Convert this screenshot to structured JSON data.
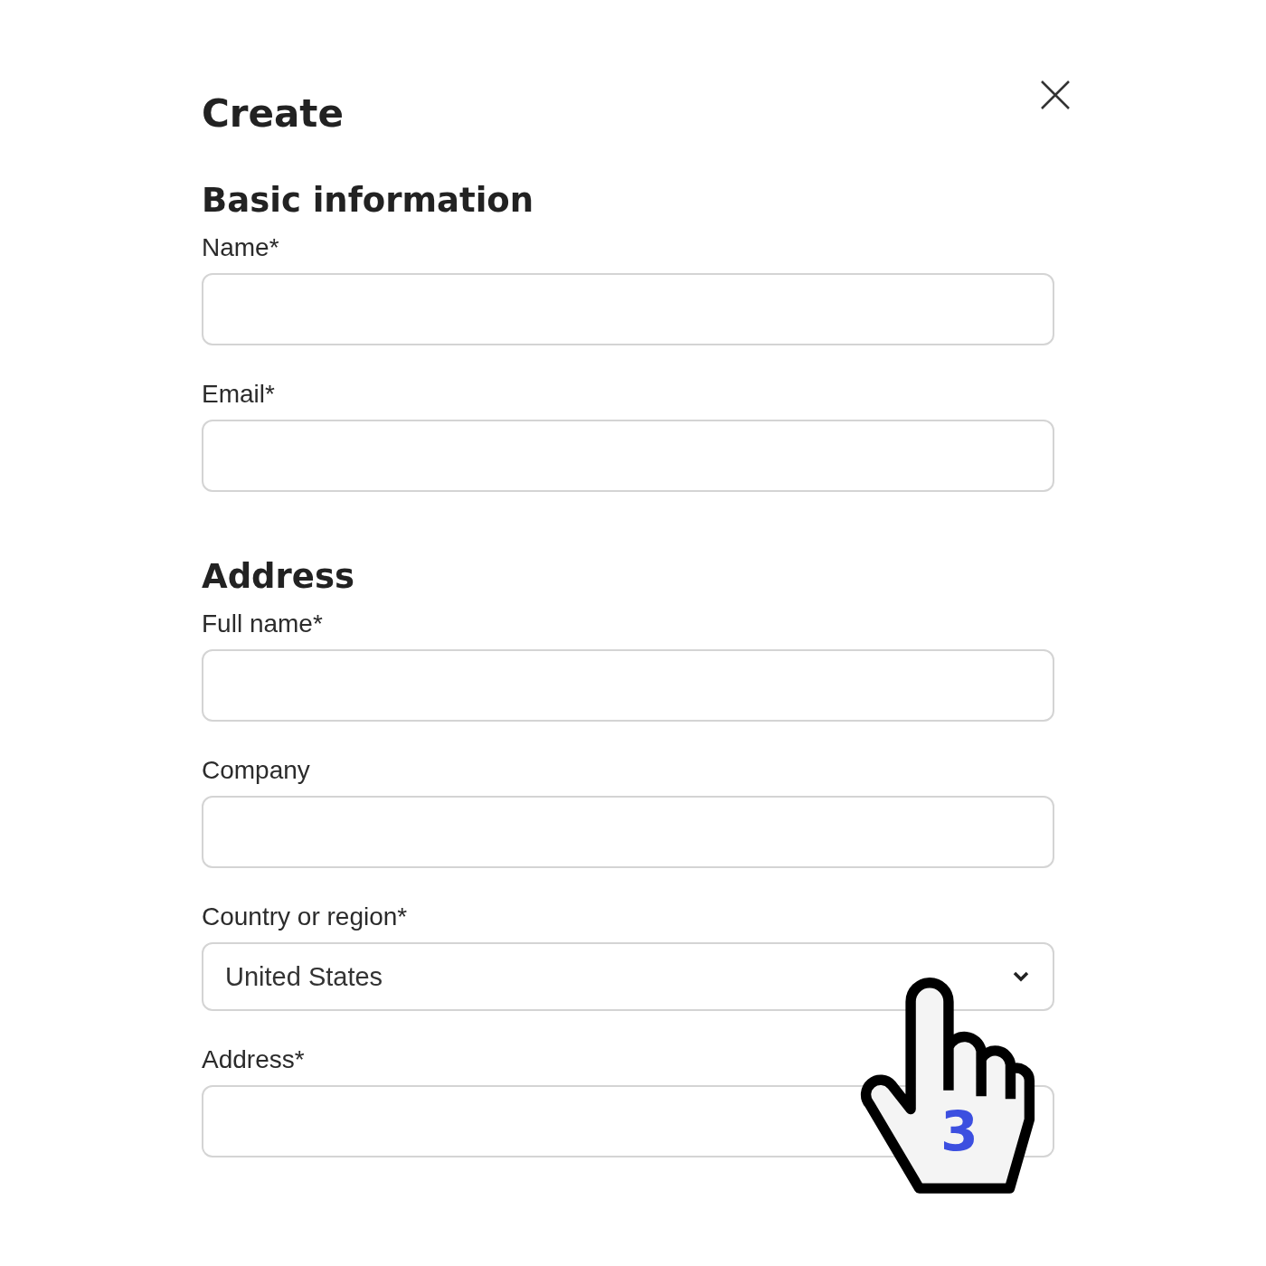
{
  "dialog": {
    "title": "Create"
  },
  "sections": [
    {
      "heading": "Basic information",
      "fields": [
        {
          "kind": "text",
          "label": "Name*"
        },
        {
          "kind": "text",
          "label": "Email*"
        }
      ]
    },
    {
      "heading": "Address",
      "fields": [
        {
          "kind": "text",
          "label": "Full name*"
        },
        {
          "kind": "text",
          "label": "Company"
        },
        {
          "kind": "select",
          "label": "Country or region*",
          "value": "United States"
        },
        {
          "kind": "text",
          "label": "Address*"
        }
      ]
    }
  ],
  "pointer": {
    "step": "3"
  }
}
